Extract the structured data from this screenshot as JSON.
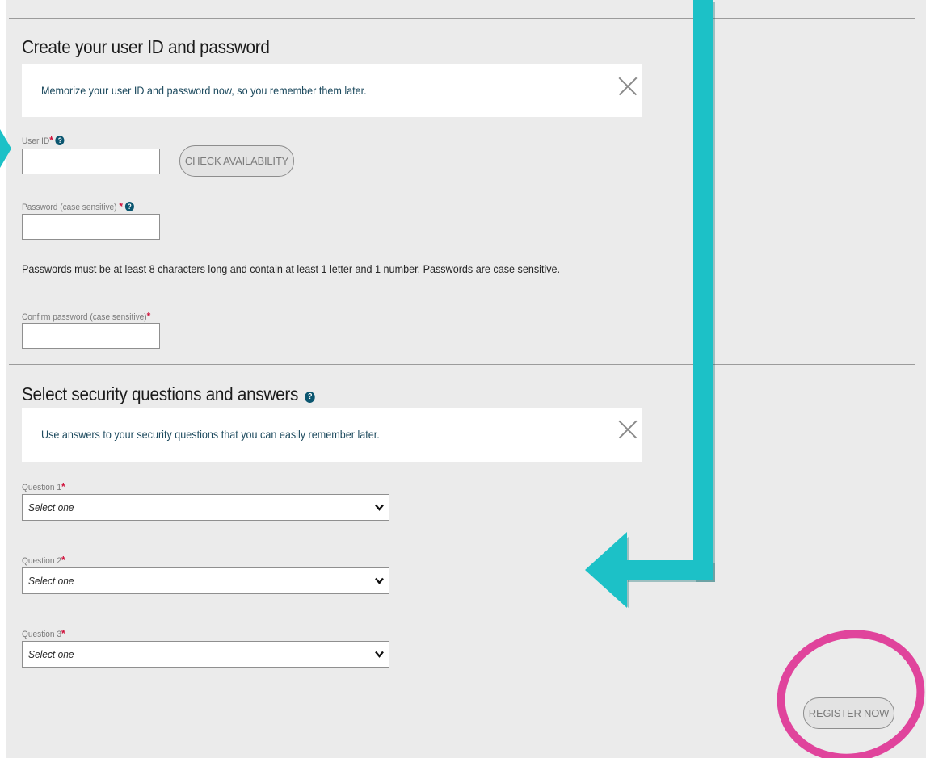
{
  "account": {
    "title": "Create your user ID and password",
    "notice": "Memorize your user ID and password now, so you remember them later.",
    "user_id": {
      "label": "User ID",
      "required_mark": "*",
      "help_glyph": "?",
      "value": ""
    },
    "check_availability_label": "CHECK AVAILABILITY",
    "password": {
      "label": "Password (case sensitive)",
      "required_mark": "*",
      "help_glyph": "?",
      "value": ""
    },
    "password_rules": "Passwords must be at least 8 characters long and contain at least 1 letter and 1 number. Passwords are case sensitive.",
    "confirm_password": {
      "label": "Confirm password (case sensitive)",
      "required_mark": "*",
      "value": ""
    }
  },
  "security": {
    "title": "Select security questions and answers",
    "help_glyph": "?",
    "notice": "Use answers to your security questions that you can easily remember later.",
    "questions": [
      {
        "label": "Question 1",
        "required_mark": "*",
        "selected": "Select one"
      },
      {
        "label": "Question 2",
        "required_mark": "*",
        "selected": "Select one"
      },
      {
        "label": "Question 3",
        "required_mark": "*",
        "selected": "Select one"
      }
    ]
  },
  "register_label": "REGISTER NOW",
  "colors": {
    "panel_background": "#ebebeb",
    "notice_text": "#1d4a5e",
    "required_mark": "#d0103a",
    "help_icon": "#0b5670",
    "annotation_arrow": "#1cc1c7",
    "annotation_circle": "#e0449c"
  }
}
